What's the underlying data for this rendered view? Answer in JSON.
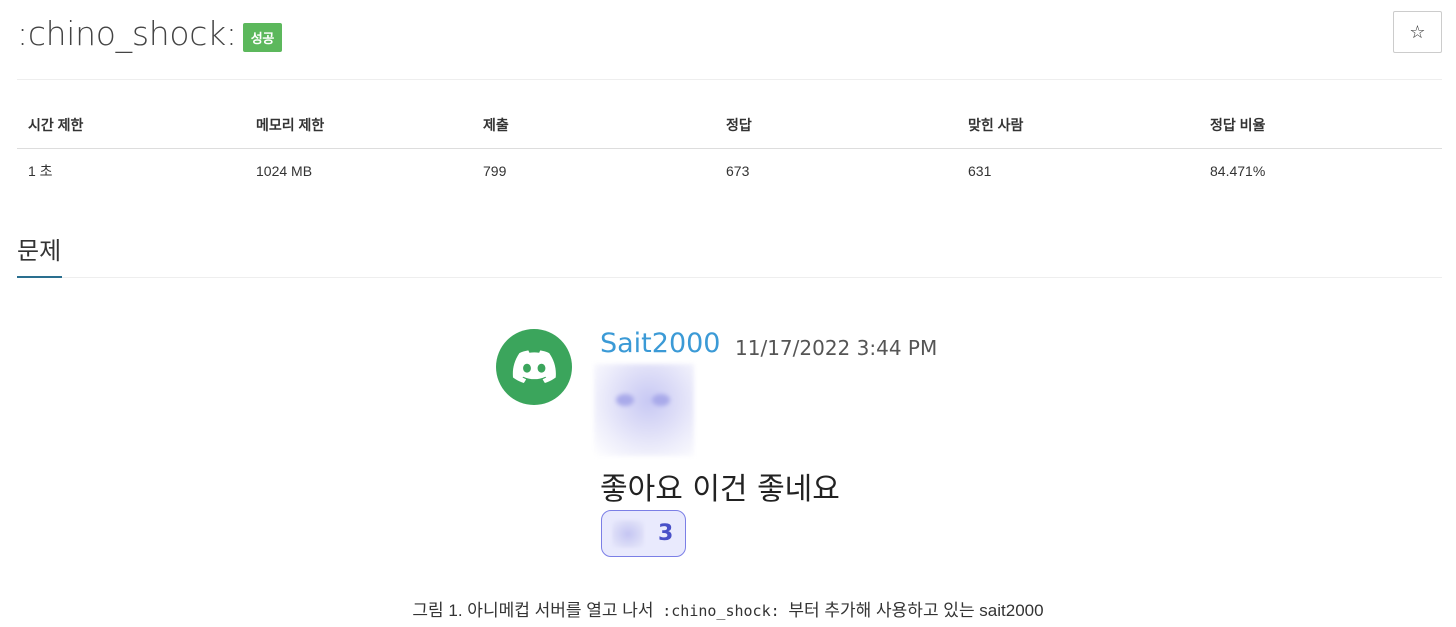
{
  "problem": {
    "title": ":chino_shock:",
    "badge": "성공",
    "star_icon": "☆"
  },
  "stats": {
    "headers": [
      "시간 제한",
      "메모리 제한",
      "제출",
      "정답",
      "맞힌 사람",
      "정답 비율"
    ],
    "values": [
      "1 초",
      "1024 MB",
      "799",
      "673",
      "631",
      "84.471%"
    ]
  },
  "section": {
    "title": "문제"
  },
  "discord": {
    "username": "Sait2000",
    "timestamp": "11/17/2022 3:44 PM",
    "message": "좋아요 이건 좋네요",
    "reaction_count": "3",
    "colors": {
      "avatar": "#3ba55c",
      "username": "#3b9ad6",
      "reaction_border": "#7b7fe6"
    }
  },
  "caption": {
    "prefix": "그림 1. 아니메컵 서버를 열고 나서 ",
    "code": ":chino_shock:",
    "suffix": " 부터 추가해 사용하고 있는 sait2000"
  }
}
